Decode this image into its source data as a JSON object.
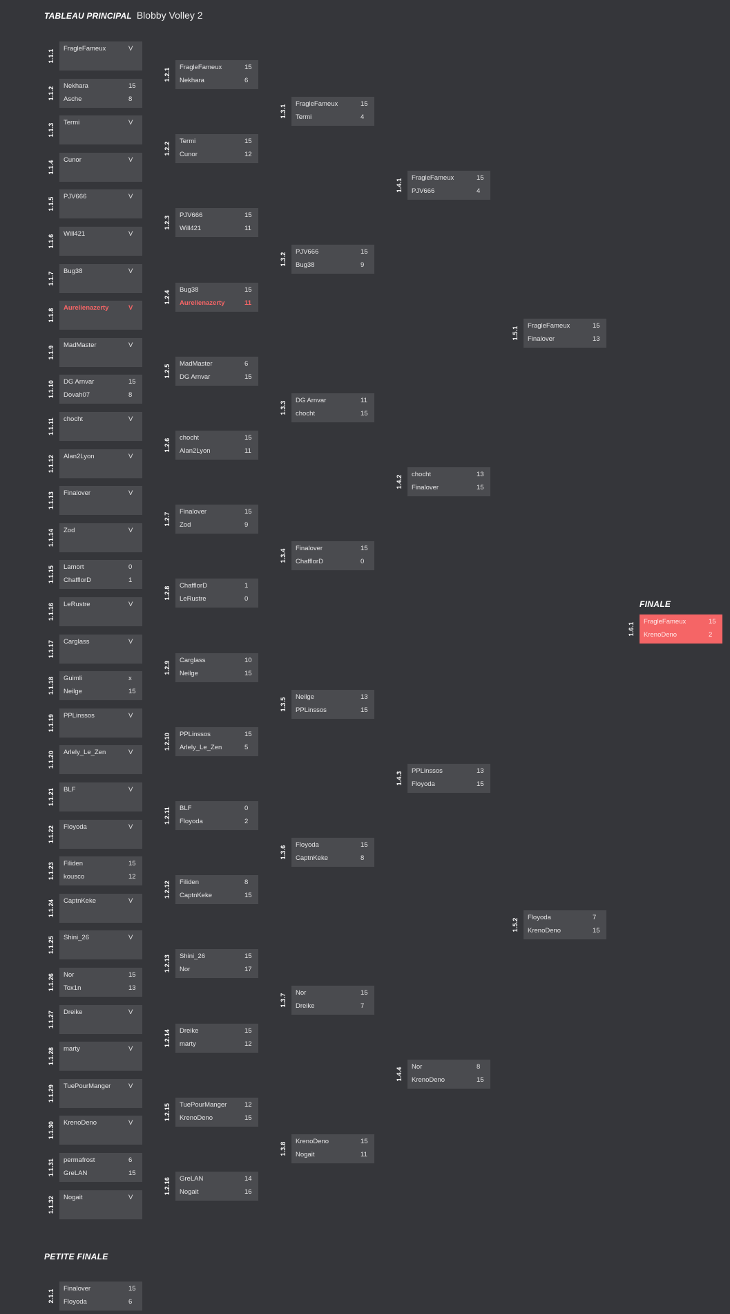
{
  "header": {
    "title_strong": "TABLEAU PRINCIPAL",
    "title_sub": "Blobby Volley 2"
  },
  "sections": {
    "finale": "FINALE",
    "petite_finale": "PETITE FINALE"
  },
  "colors": {
    "background": "#35363a",
    "box": "#4a4b4f",
    "accent": "#f56566"
  },
  "rounds": [
    {
      "round": 1,
      "matches": [
        {
          "id": "1.1.1",
          "p1": "FragleFameux",
          "s1": "V",
          "p2": "",
          "s2": ""
        },
        {
          "id": "1.1.2",
          "p1": "Nekhara",
          "s1": "15",
          "p2": "Asche",
          "s2": "8"
        },
        {
          "id": "1.1.3",
          "p1": "Termi",
          "s1": "V",
          "p2": "",
          "s2": ""
        },
        {
          "id": "1.1.4",
          "p1": "Cunor",
          "s1": "V",
          "p2": "",
          "s2": ""
        },
        {
          "id": "1.1.5",
          "p1": "PJV666",
          "s1": "V",
          "p2": "",
          "s2": ""
        },
        {
          "id": "1.1.6",
          "p1": "Will421",
          "s1": "V",
          "p2": "",
          "s2": ""
        },
        {
          "id": "1.1.7",
          "p1": "Bug38",
          "s1": "V",
          "p2": "",
          "s2": ""
        },
        {
          "id": "1.1.8",
          "p1": "Aurelienazerty",
          "s1": "V",
          "p2": "",
          "s2": "",
          "highlight": "p1"
        },
        {
          "id": "1.1.9",
          "p1": "MadMaster",
          "s1": "V",
          "p2": "",
          "s2": ""
        },
        {
          "id": "1.1.10",
          "p1": "DG Arnvar",
          "s1": "15",
          "p2": "Dovah07",
          "s2": "8"
        },
        {
          "id": "1.1.11",
          "p1": "chocht",
          "s1": "V",
          "p2": "",
          "s2": ""
        },
        {
          "id": "1.1.12",
          "p1": "Alan2Lyon",
          "s1": "V",
          "p2": "",
          "s2": ""
        },
        {
          "id": "1.1.13",
          "p1": "Finalover",
          "s1": "V",
          "p2": "",
          "s2": ""
        },
        {
          "id": "1.1.14",
          "p1": "Zod",
          "s1": "V",
          "p2": "",
          "s2": ""
        },
        {
          "id": "1.1.15",
          "p1": "Lamort",
          "s1": "0",
          "p2": "ChafflorD",
          "s2": "1"
        },
        {
          "id": "1.1.16",
          "p1": "LeRustre",
          "s1": "V",
          "p2": "",
          "s2": ""
        },
        {
          "id": "1.1.17",
          "p1": "Carglass",
          "s1": "V",
          "p2": "",
          "s2": ""
        },
        {
          "id": "1.1.18",
          "p1": "Guimli",
          "s1": "x",
          "p2": "Neilge",
          "s2": "15"
        },
        {
          "id": "1.1.19",
          "p1": "PPLinssos",
          "s1": "V",
          "p2": "",
          "s2": ""
        },
        {
          "id": "1.1.20",
          "p1": "Arlely_Le_Zen",
          "s1": "V",
          "p2": "",
          "s2": ""
        },
        {
          "id": "1.1.21",
          "p1": "BLF",
          "s1": "V",
          "p2": "",
          "s2": ""
        },
        {
          "id": "1.1.22",
          "p1": "Floyoda",
          "s1": "V",
          "p2": "",
          "s2": ""
        },
        {
          "id": "1.1.23",
          "p1": "Filiden",
          "s1": "15",
          "p2": "kousco",
          "s2": "12"
        },
        {
          "id": "1.1.24",
          "p1": "CaptnKeke",
          "s1": "V",
          "p2": "",
          "s2": ""
        },
        {
          "id": "1.1.25",
          "p1": "Shini_26",
          "s1": "V",
          "p2": "",
          "s2": ""
        },
        {
          "id": "1.1.26",
          "p1": "Nor",
          "s1": "15",
          "p2": "Tox1n",
          "s2": "13"
        },
        {
          "id": "1.1.27",
          "p1": "Dreike",
          "s1": "V",
          "p2": "",
          "s2": ""
        },
        {
          "id": "1.1.28",
          "p1": "marty",
          "s1": "V",
          "p2": "",
          "s2": ""
        },
        {
          "id": "1.1.29",
          "p1": "TuePourManger",
          "s1": "V",
          "p2": "",
          "s2": ""
        },
        {
          "id": "1.1.30",
          "p1": "KrenoDeno",
          "s1": "V",
          "p2": "",
          "s2": ""
        },
        {
          "id": "1.1.31",
          "p1": "permafrost",
          "s1": "6",
          "p2": "GreLAN",
          "s2": "15"
        },
        {
          "id": "1.1.32",
          "p1": "Nogait",
          "s1": "V",
          "p2": "",
          "s2": ""
        }
      ]
    },
    {
      "round": 2,
      "matches": [
        {
          "id": "1.2.1",
          "p1": "FragleFameux",
          "s1": "15",
          "p2": "Nekhara",
          "s2": "6"
        },
        {
          "id": "1.2.2",
          "p1": "Termi",
          "s1": "15",
          "p2": "Cunor",
          "s2": "12"
        },
        {
          "id": "1.2.3",
          "p1": "PJV666",
          "s1": "15",
          "p2": "Will421",
          "s2": "11"
        },
        {
          "id": "1.2.4",
          "p1": "Bug38",
          "s1": "15",
          "p2": "Aurelienazerty",
          "s2": "11",
          "highlight": "p2"
        },
        {
          "id": "1.2.5",
          "p1": "MadMaster",
          "s1": "6",
          "p2": "DG Arnvar",
          "s2": "15"
        },
        {
          "id": "1.2.6",
          "p1": "chocht",
          "s1": "15",
          "p2": "Alan2Lyon",
          "s2": "11"
        },
        {
          "id": "1.2.7",
          "p1": "Finalover",
          "s1": "15",
          "p2": "Zod",
          "s2": "9"
        },
        {
          "id": "1.2.8",
          "p1": "ChafflorD",
          "s1": "1",
          "p2": "LeRustre",
          "s2": "0"
        },
        {
          "id": "1.2.9",
          "p1": "Carglass",
          "s1": "10",
          "p2": "Neilge",
          "s2": "15"
        },
        {
          "id": "1.2.10",
          "p1": "PPLinssos",
          "s1": "15",
          "p2": "Arlely_Le_Zen",
          "s2": "5"
        },
        {
          "id": "1.2.11",
          "p1": "BLF",
          "s1": "0",
          "p2": "Floyoda",
          "s2": "2"
        },
        {
          "id": "1.2.12",
          "p1": "Filiden",
          "s1": "8",
          "p2": "CaptnKeke",
          "s2": "15"
        },
        {
          "id": "1.2.13",
          "p1": "Shini_26",
          "s1": "15",
          "p2": "Nor",
          "s2": "17"
        },
        {
          "id": "1.2.14",
          "p1": "Dreike",
          "s1": "15",
          "p2": "marty",
          "s2": "12"
        },
        {
          "id": "1.2.15",
          "p1": "TuePourManger",
          "s1": "12",
          "p2": "KrenoDeno",
          "s2": "15"
        },
        {
          "id": "1.2.16",
          "p1": "GreLAN",
          "s1": "14",
          "p2": "Nogait",
          "s2": "16"
        }
      ]
    },
    {
      "round": 3,
      "matches": [
        {
          "id": "1.3.1",
          "p1": "FragleFameux",
          "s1": "15",
          "p2": "Termi",
          "s2": "4"
        },
        {
          "id": "1.3.2",
          "p1": "PJV666",
          "s1": "15",
          "p2": "Bug38",
          "s2": "9"
        },
        {
          "id": "1.3.3",
          "p1": "DG Arnvar",
          "s1": "11",
          "p2": "chocht",
          "s2": "15"
        },
        {
          "id": "1.3.4",
          "p1": "Finalover",
          "s1": "15",
          "p2": "ChafflorD",
          "s2": "0"
        },
        {
          "id": "1.3.5",
          "p1": "Neilge",
          "s1": "13",
          "p2": "PPLinssos",
          "s2": "15"
        },
        {
          "id": "1.3.6",
          "p1": "Floyoda",
          "s1": "15",
          "p2": "CaptnKeke",
          "s2": "8"
        },
        {
          "id": "1.3.7",
          "p1": "Nor",
          "s1": "15",
          "p2": "Dreike",
          "s2": "7"
        },
        {
          "id": "1.3.8",
          "p1": "KrenoDeno",
          "s1": "15",
          "p2": "Nogait",
          "s2": "11"
        }
      ]
    },
    {
      "round": 4,
      "matches": [
        {
          "id": "1.4.1",
          "p1": "FragleFameux",
          "s1": "15",
          "p2": "PJV666",
          "s2": "4"
        },
        {
          "id": "1.4.2",
          "p1": "chocht",
          "s1": "13",
          "p2": "Finalover",
          "s2": "15"
        },
        {
          "id": "1.4.3",
          "p1": "PPLinssos",
          "s1": "13",
          "p2": "Floyoda",
          "s2": "15"
        },
        {
          "id": "1.4.4",
          "p1": "Nor",
          "s1": "8",
          "p2": "KrenoDeno",
          "s2": "15"
        }
      ]
    },
    {
      "round": 5,
      "matches": [
        {
          "id": "1.5.1",
          "p1": "FragleFameux",
          "s1": "15",
          "p2": "Finalover",
          "s2": "13"
        },
        {
          "id": "1.5.2",
          "p1": "Floyoda",
          "s1": "7",
          "p2": "KrenoDeno",
          "s2": "15"
        }
      ]
    }
  ],
  "final": {
    "id": "1.6.1",
    "p1": "FragleFameux",
    "s1": "15",
    "p2": "KrenoDeno",
    "s2": "2"
  },
  "petite_finale": {
    "id": "2.1.1",
    "p1": "Finalover",
    "s1": "15",
    "p2": "Floyoda",
    "s2": "6"
  }
}
